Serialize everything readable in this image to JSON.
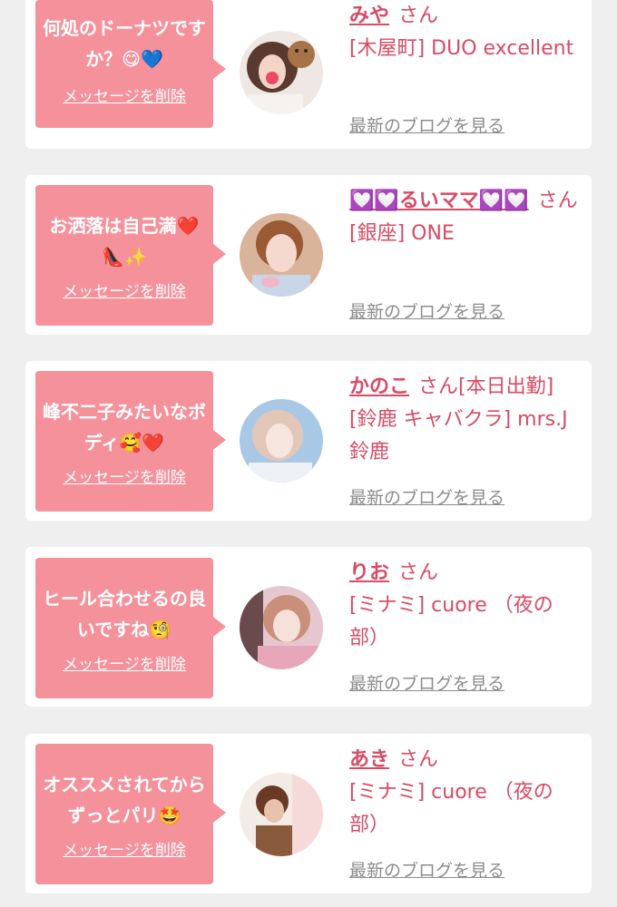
{
  "colors": {
    "background": "#efefef",
    "card": "#ffffff",
    "bubble": "#f5919b",
    "accent_text": "#d94a64",
    "link_gray": "#8c8c8c"
  },
  "icons": {
    "avatar_placeholder": "woman-portrait-photo",
    "delete": "text-link"
  },
  "messages": [
    {
      "text": "何処のドーナツですか？😋💙",
      "delete_label": "メッセージを削除",
      "cast_name": "みや",
      "honorific": "さん",
      "extra": "",
      "shop": "[木屋町] DUO excellent",
      "blog_label": "最新のブログを見る"
    },
    {
      "text": "お洒落は自己満❤️👠✨",
      "delete_label": "メッセージを削除",
      "cast_name": "💟💟るいママ💟💟",
      "honorific": "さん",
      "extra": "",
      "shop": "[銀座] ONE",
      "blog_label": "最新のブログを見る"
    },
    {
      "text": "峰不二子みたいなボディ🥰❤️",
      "delete_label": "メッセージを削除",
      "cast_name": "かのこ",
      "honorific": "さん",
      "extra": "[本日出勤]",
      "shop": "[鈴鹿 キャバクラ] mrs.J 鈴鹿",
      "blog_label": "最新のブログを見る"
    },
    {
      "text": "ヒール合わせるの良いですね🧐",
      "delete_label": "メッセージを削除",
      "cast_name": "りお",
      "honorific": "さん",
      "extra": "",
      "shop": "[ミナミ] cuore （夜の部）",
      "blog_label": "最新のブログを見る"
    },
    {
      "text": "オススメされてからずっとパリ🤩",
      "delete_label": "メッセージを削除",
      "cast_name": "あき",
      "honorific": "さん",
      "extra": "",
      "shop": "[ミナミ] cuore （夜の部）",
      "blog_label": "最新のブログを見る"
    }
  ]
}
